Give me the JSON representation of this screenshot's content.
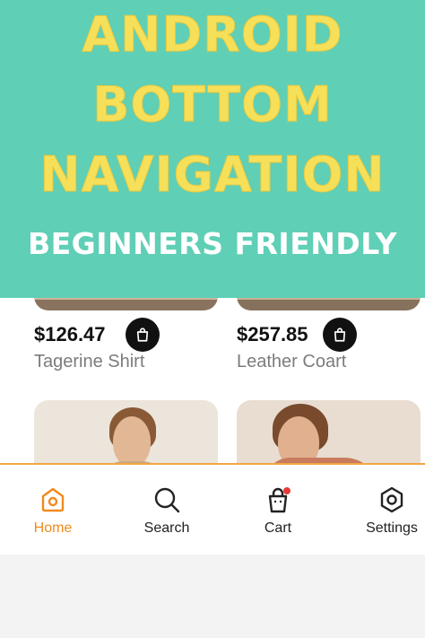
{
  "banner": {
    "line1": "ANDROID",
    "line2": "BOTTOM",
    "line3": "NAVIGATION",
    "subtitle": "BEGINNERS FRIENDLY"
  },
  "products": [
    {
      "price": "$126.47",
      "name": "Tagerine Shirt",
      "action_icon": "shopping-bag-icon"
    },
    {
      "price": "$257.85",
      "name": "Leather Coart",
      "action_icon": "shopping-bag-icon"
    }
  ],
  "nav": {
    "items": [
      {
        "label": "Home",
        "icon": "home-icon",
        "active": true
      },
      {
        "label": "Search",
        "icon": "search-icon",
        "active": false
      },
      {
        "label": "Cart",
        "icon": "cart-icon",
        "active": false,
        "badge": true
      },
      {
        "label": "Settings",
        "icon": "settings-icon",
        "active": false
      }
    ]
  },
  "colors": {
    "banner_bg": "#5fcfb6",
    "headline": "#f6e05a",
    "accent": "#f08a1c",
    "badge": "#e53935"
  }
}
